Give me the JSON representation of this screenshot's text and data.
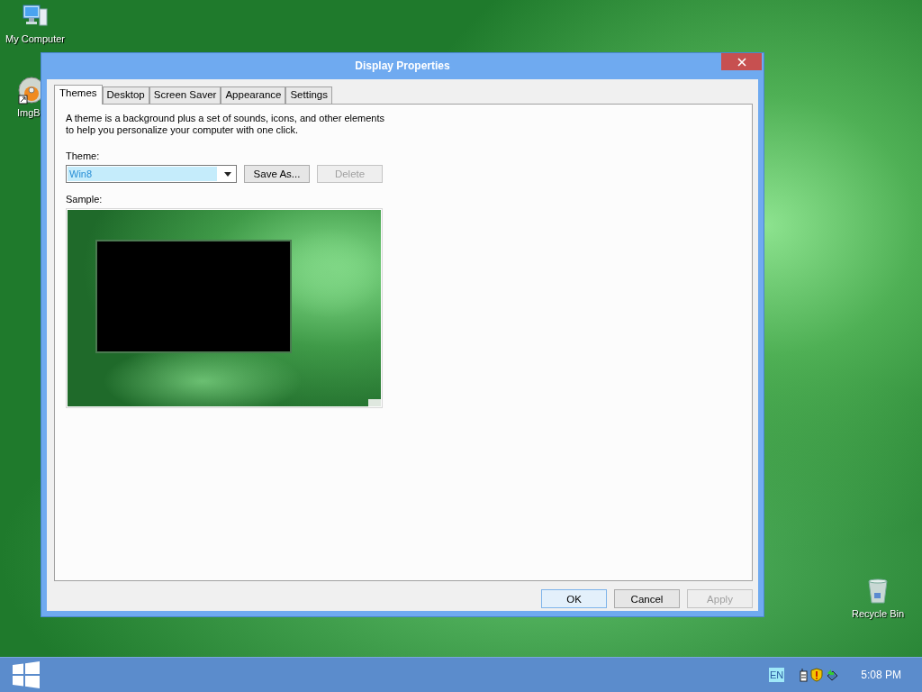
{
  "desktop_icons": [
    {
      "label": "My Computer",
      "kind": "computer"
    },
    {
      "label": "ImgB",
      "kind": "disc"
    },
    {
      "label": "Recycle Bin",
      "kind": "bin"
    }
  ],
  "window": {
    "title": "Display Properties",
    "tabs": [
      {
        "label": "Themes",
        "selected": true
      },
      {
        "label": "Desktop",
        "selected": false
      },
      {
        "label": "Screen Saver",
        "selected": false
      },
      {
        "label": "Appearance",
        "selected": false
      },
      {
        "label": "Settings",
        "selected": false
      }
    ],
    "description": "A theme is a background plus a set of sounds, icons, and other elements to help you personalize your computer with one click.",
    "theme_label": "Theme:",
    "theme_dropdown": {
      "value": "Win8"
    },
    "theme_buttons": [
      {
        "label": "Save As...",
        "disabled": false
      },
      {
        "label": "Delete",
        "disabled": true
      }
    ],
    "sample_label": "Sample:",
    "buttons": [
      {
        "label": "OK",
        "disabled": false,
        "default": true
      },
      {
        "label": "Cancel",
        "disabled": false,
        "default": false
      },
      {
        "label": "Apply",
        "disabled": true,
        "default": false
      }
    ]
  },
  "taskbar": {
    "language": "EN",
    "clock": "5:08 PM"
  }
}
